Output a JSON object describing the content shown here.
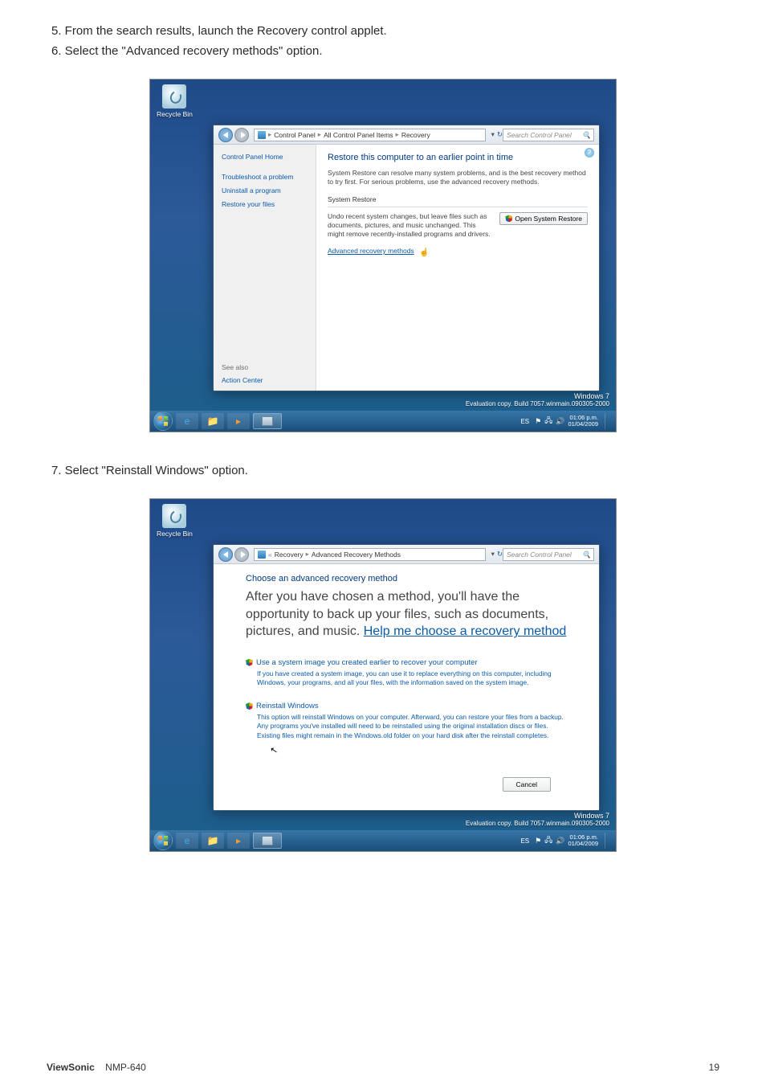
{
  "steps": {
    "step5": "5. From the search results, launch the Recovery control applet.",
    "step6": "6. Select the \"Advanced recovery methods\" option.",
    "step7": "7. Select \"Reinstall Windows\" option."
  },
  "desktop": {
    "recycle_bin": "Recycle Bin"
  },
  "screenshot1": {
    "titlebar": {
      "min": "—",
      "max": "▢",
      "close": "✕"
    },
    "breadcrumb": {
      "seg1": "Control Panel",
      "seg2": "All Control Panel Items",
      "seg3": "Recovery"
    },
    "search_placeholder": "Search Control Panel",
    "sidebar": {
      "home": "Control Panel Home",
      "troubleshoot": "Troubleshoot a problem",
      "uninstall": "Uninstall a program",
      "restore_files": "Restore your files",
      "see_also": "See also",
      "action_center": "Action Center"
    },
    "content": {
      "heading": "Restore this computer to an earlier point in time",
      "para": "System Restore can resolve many system problems, and is the best recovery method to try first. For serious problems, use the advanced recovery methods.",
      "section_label": "System Restore",
      "restore_desc": "Undo recent system changes, but leave files such as documents, pictures, and music unchanged. This might remove recently-installed programs and drivers.",
      "open_restore": "Open System Restore",
      "adv_link": "Advanced recovery methods"
    },
    "help_mark": "?"
  },
  "screenshot2": {
    "breadcrumb": {
      "seg1": "Recovery",
      "seg2": "Advanced Recovery Methods"
    },
    "search_placeholder": "Search Control Panel",
    "heading": "Choose an advanced recovery method",
    "sub_text": "After you have chosen a method, you'll have the opportunity to back up your files, such as documents, pictures, and music. ",
    "sub_link": "Help me choose a recovery method",
    "opt1_title": "Use a system image you created earlier to recover your computer",
    "opt1_desc": "If you have created a system image, you can use it to replace everything on this computer, including Windows, your programs, and all your files, with the information saved on the system image.",
    "opt2_title": "Reinstall Windows",
    "opt2_desc": "This option will reinstall Windows on your computer. Afterward, you can restore your files from a backup. Any programs you've installed will need to be reinstalled using the original installation discs or files. Existing files might remain in the Windows.old folder on your hard disk after the reinstall completes.",
    "cancel": "Cancel"
  },
  "watermark": {
    "title": "Windows 7",
    "build": "Evaluation copy. Build 7057.winmain.090305-2000"
  },
  "taskbar": {
    "lang": "ES",
    "clock_line1": "01:06 p.m.",
    "clock_line2": "01/04/2009"
  },
  "footer": {
    "brand": "ViewSonic",
    "model": "NMP-640",
    "page": "19"
  }
}
